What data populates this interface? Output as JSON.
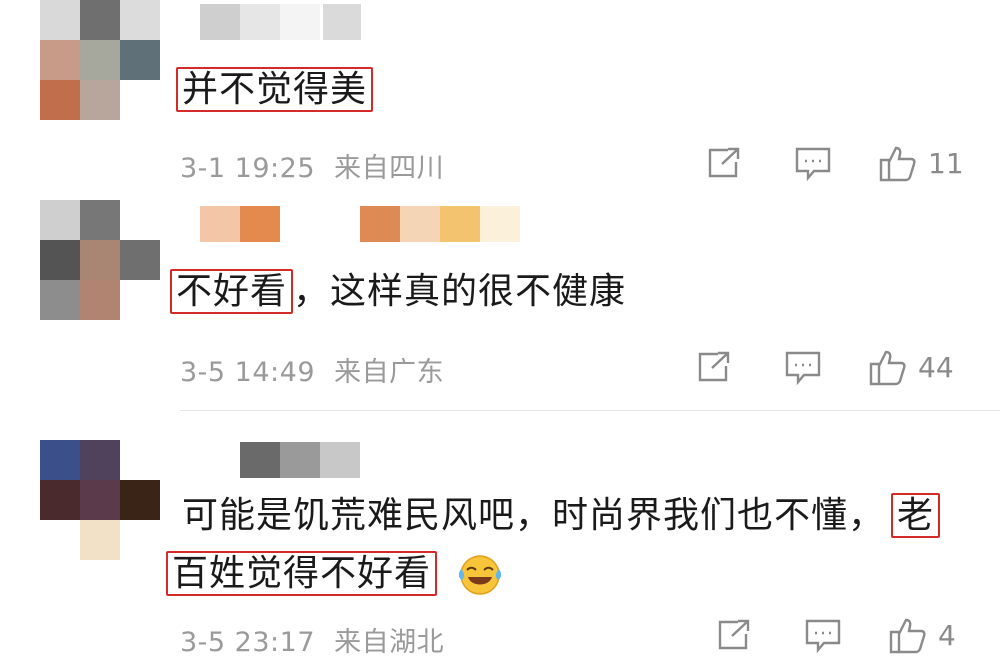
{
  "comments": [
    {
      "text_highlight": "并不觉得美",
      "text_rest": "",
      "time": "3-1 19:25",
      "location": "来自四川",
      "likes": "11"
    },
    {
      "text_highlight": "不好看",
      "text_rest": "，这样真的很不健康",
      "time": "3-5 14:49",
      "location": "来自广东",
      "likes": "44"
    },
    {
      "line1_plain": "可能是饥荒难民风吧，时尚界我们也不懂，",
      "line1_highlight": "老",
      "line2_highlight": "百姓觉得不好看",
      "emoji": "laugh-cry-emoji",
      "time": "3-5 23:17",
      "location": "来自湖北",
      "likes": "4"
    }
  ],
  "icons": {
    "share": "share-icon",
    "comment": "comment-icon",
    "like": "thumbs-up-icon"
  },
  "colors": {
    "highlight_border": "#d42a2a",
    "meta_text": "#9a9a9a"
  }
}
